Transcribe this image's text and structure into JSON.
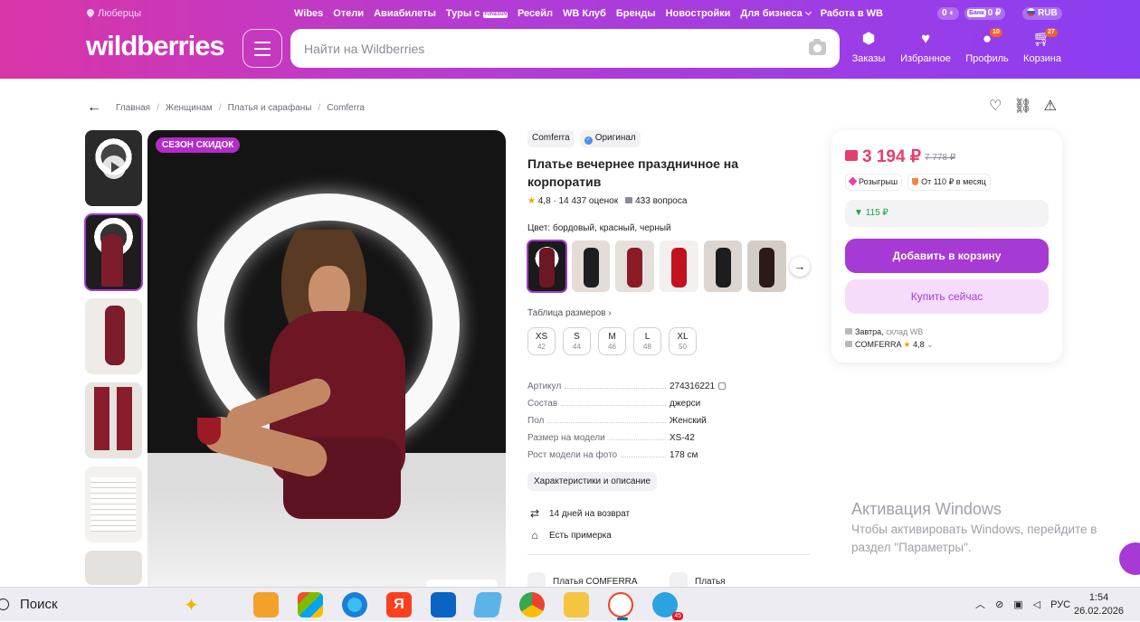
{
  "header": {
    "location": "Люберцы",
    "top_links": [
      "Wibes",
      "Отели",
      "Авиабилеты",
      "Туры с",
      "Ресейл",
      "WB Клуб",
      "Бренды",
      "Новостройки",
      "Для бизнеса",
      "Работа в WB"
    ],
    "fun_badge": "FUN&SUN",
    "balance": "0",
    "bank_label": "Банк",
    "bank_balance": "0 ₽",
    "currency": "RUB",
    "logo": "wildberries",
    "search_placeholder": "Найти на Wildberries",
    "icons": [
      {
        "label": "Заказы",
        "icon": "box-icon",
        "badge": ""
      },
      {
        "label": "Избранное",
        "icon": "heart-icon",
        "badge": ""
      },
      {
        "label": "Профиль",
        "icon": "user-icon",
        "badge": "10"
      },
      {
        "label": "Корзина",
        "icon": "cart-icon",
        "badge": "27"
      }
    ]
  },
  "breadcrumb": [
    "Главная",
    "Женщинам",
    "Платья и сарафаны",
    "Comferra"
  ],
  "gallery": {
    "sale_badge": "СЕЗОН СКИДОК",
    "thumb_count": 6,
    "selected_thumb": 2
  },
  "product": {
    "brand": "Comferra",
    "original_label": "Оригинал",
    "title": "Платье вечернее праздничное на корпоратив",
    "rating": "4,8",
    "reviews": "14 437 оценок",
    "questions": "433 вопроса",
    "color_label": "Цвет:",
    "color_value": "бордовый, красный, черный",
    "size_table_link": "Таблица размеров",
    "sizes": [
      {
        "ru": "XS",
        "num": "42"
      },
      {
        "ru": "S",
        "num": "44"
      },
      {
        "ru": "M",
        "num": "46"
      },
      {
        "ru": "L",
        "num": "48"
      },
      {
        "ru": "XL",
        "num": "50"
      }
    ],
    "specs": [
      {
        "k": "Артикул",
        "v": "274316221"
      },
      {
        "k": "Состав",
        "v": "джерси"
      },
      {
        "k": "Пол",
        "v": "Женский"
      },
      {
        "k": "Размер на модели",
        "v": "XS-42"
      },
      {
        "k": "Рост модели на фото",
        "v": "178 см"
      }
    ],
    "chars_button": "Характеристики и описание",
    "perks": [
      "14 дней на возврат",
      "Есть примерка"
    ],
    "brand_link": "Платья COMFERRA",
    "category_link": "Платья"
  },
  "buybox": {
    "price": "3 194 ₽",
    "old_price": "7 778 ₽",
    "tag_lottery": "Розыгрыш",
    "tag_installment": "От 110 ₽ в месяц",
    "cashback": "115 ₽",
    "add_to_cart": "Добавить в корзину",
    "buy_now": "Купить сейчас",
    "delivery_day": "Завтра,",
    "warehouse": "склад WB",
    "seller": "COMFERRA",
    "seller_rating": "4,8"
  },
  "windows": {
    "activation_title": "Активация Windows",
    "activation_text_1": "Чтобы активировать Windows, перейдите в",
    "activation_text_2": "раздел \"Параметры\".",
    "search": "Поиск",
    "lang": "РУС",
    "time": "1:54",
    "date": "26.02.2026",
    "telegram_badge": "45"
  },
  "colors": {
    "accent": "#a73ad4",
    "price": "#e53e6b",
    "dress": "#7d1c2a"
  }
}
